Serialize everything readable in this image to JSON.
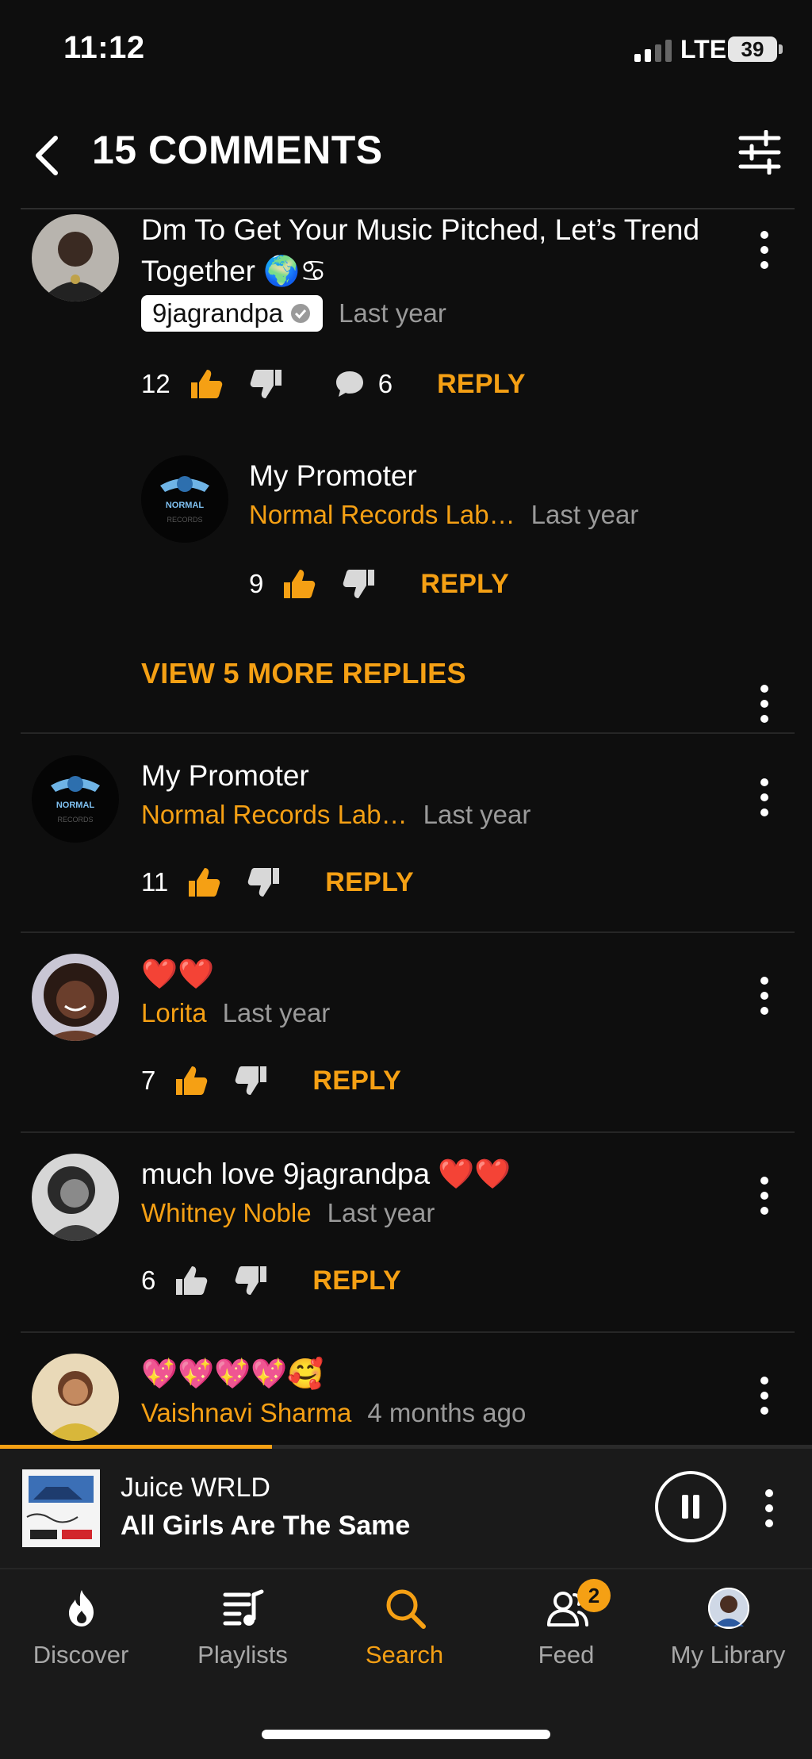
{
  "status_bar": {
    "time": "11:12",
    "network": "LTE",
    "battery": "39"
  },
  "header": {
    "title": "15 COMMENTS"
  },
  "comments": [
    {
      "text": "Dm To Get Your Music Pitched, Let’s Trend Together 🌍♋",
      "user": "9jagrandpa",
      "time": "Last year",
      "likes": "12",
      "replies_count": "6",
      "reply_label": "REPLY"
    },
    {
      "text": "My Promoter",
      "user": "Normal Records Lab…",
      "time": "Last year",
      "likes": "9",
      "reply_label": "REPLY"
    },
    {
      "text": "My Promoter",
      "user": "Normal Records Lab…",
      "time": "Last year",
      "likes": "11",
      "reply_label": "REPLY"
    },
    {
      "text": "❤️❤️",
      "user": "Lorita",
      "time": "Last year",
      "likes": "7",
      "reply_label": "REPLY"
    },
    {
      "text": "much love 9jagrandpa ❤️❤️",
      "user": "Whitney Noble",
      "time": "Last year",
      "likes": "6",
      "reply_label": "REPLY"
    },
    {
      "text": "💖💖💖💖🥰",
      "user": "Vaishnavi Sharma",
      "time": "4 months ago"
    }
  ],
  "view_more": "VIEW 5 MORE REPLIES",
  "player": {
    "artist": "Juice WRLD",
    "track": "All Girls Are The Same",
    "progress": 0.335
  },
  "tabs": [
    {
      "label": "Discover",
      "icon": "flame-icon"
    },
    {
      "label": "Playlists",
      "icon": "playlist-icon"
    },
    {
      "label": "Search",
      "icon": "search-icon",
      "active": true
    },
    {
      "label": "Feed",
      "icon": "people-icon",
      "badge": "2"
    },
    {
      "label": "My Library",
      "icon": "avatar-icon"
    }
  ],
  "colors": {
    "accent": "#f5a014",
    "background": "#0e0e0e",
    "panel": "#1a1a1a"
  }
}
